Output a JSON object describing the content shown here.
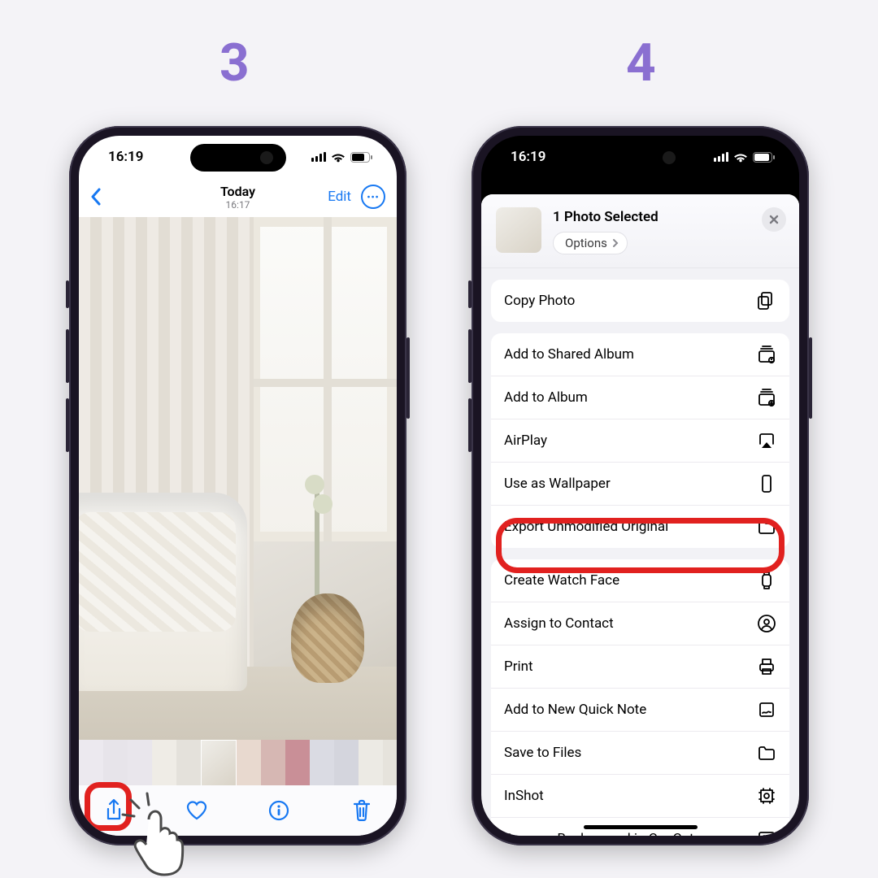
{
  "steps": {
    "left": "3",
    "right": "4"
  },
  "status": {
    "time": "16:19"
  },
  "photos": {
    "title": "Today",
    "subtitle": "16:17",
    "edit": "Edit"
  },
  "share": {
    "selected": "1 Photo Selected",
    "options": "Options",
    "groups": [
      {
        "rows": [
          {
            "label": "Copy Photo",
            "icon": "copy"
          }
        ]
      },
      {
        "rows": [
          {
            "label": "Add to Shared Album",
            "icon": "shared-album"
          },
          {
            "label": "Add to Album",
            "icon": "album"
          },
          {
            "label": "AirPlay",
            "icon": "airplay"
          },
          {
            "label": "Use as Wallpaper",
            "icon": "wallpaper",
            "highlight": true
          },
          {
            "label": "Export Unmodified Original",
            "icon": "folder"
          }
        ]
      },
      {
        "rows": [
          {
            "label": "Create Watch Face",
            "icon": "watch"
          },
          {
            "label": "Assign to Contact",
            "icon": "contact"
          },
          {
            "label": "Print",
            "icon": "print"
          },
          {
            "label": "Add to New Quick Note",
            "icon": "note"
          },
          {
            "label": "Save to Files",
            "icon": "folder"
          },
          {
            "label": "InShot",
            "icon": "crop"
          },
          {
            "label": "Remove Background in CapCut",
            "icon": "image"
          }
        ]
      }
    ]
  },
  "highlight_color": "#e1211f"
}
